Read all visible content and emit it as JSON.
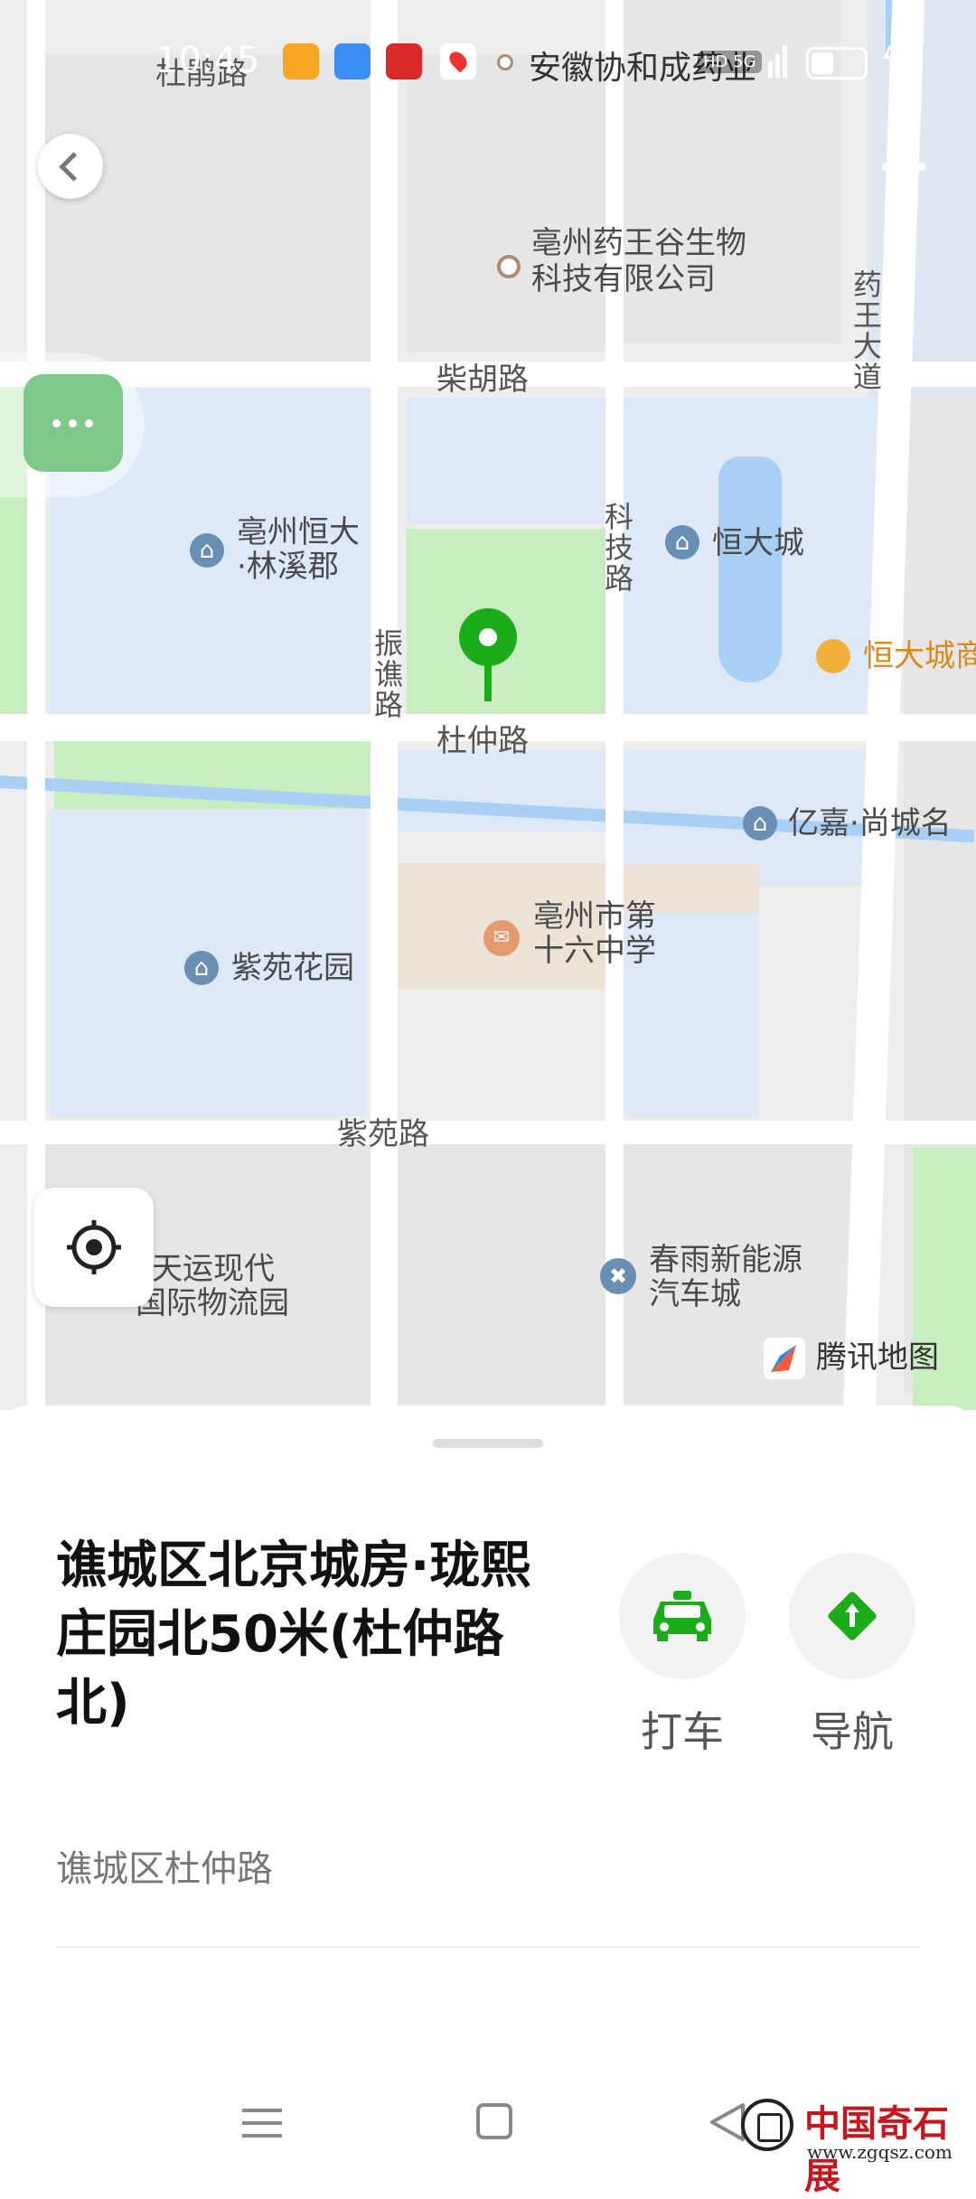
{
  "status_bar": {
    "time": "10:45",
    "notification_text": "安徽协和成药业",
    "network": "HD 5G"
  },
  "map": {
    "roads": {
      "top_road": "杜鹃路",
      "chaihu": "柴胡路",
      "keji": "科技路",
      "zhenqiao": "振谯路",
      "duzhong": "杜仲路",
      "ziyuan": "紫苑路",
      "yaowang": "药王大道"
    },
    "pois": {
      "yaowanggu_line1": "亳州药王谷生物",
      "yaowanggu_line2": "科技有限公司",
      "linxijun_line1": "亳州恒大",
      "linxijun_line2": "·林溪郡",
      "hengdacheng": "恒大城",
      "hengdacheng_shop": "恒大城商",
      "yijia": "亿嘉·尚城名",
      "school_line1": "亳州市第",
      "school_line2": "十六中学",
      "ziyuan_garden": "紫苑花园",
      "tianyun_line1": "天运现代",
      "tianyun_line2": "国际物流园",
      "chunyu_line1": "春雨新能源",
      "chunyu_line2": "汽车城"
    },
    "brand": "腾讯地图"
  },
  "location": {
    "title": "谯城区北京城房·珑熙庄园北50米(杜仲路北)",
    "subtitle": "谯城区杜仲路"
  },
  "actions": {
    "taxi_label": "打车",
    "nav_label": "导航"
  },
  "watermark": {
    "text": "中国奇石展",
    "url": "www.zgqsz.com"
  },
  "colors": {
    "accent": "#1aad19",
    "residential_blue": "#dde9f7",
    "park_green": "#c7edc0",
    "water": "#a9cff5"
  }
}
